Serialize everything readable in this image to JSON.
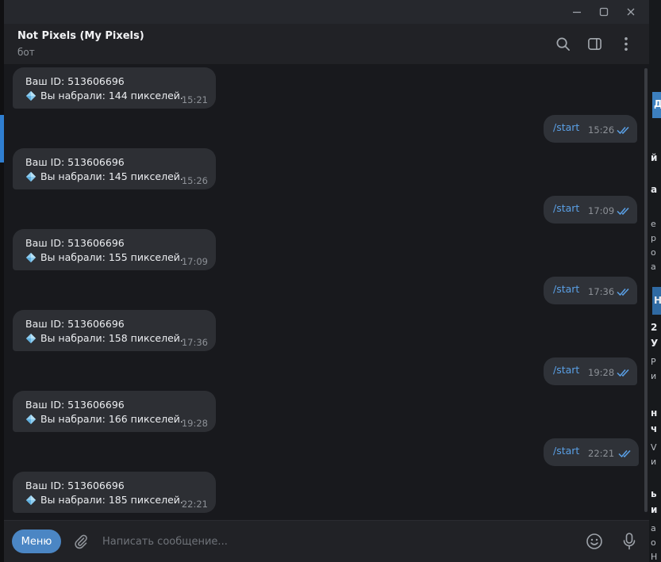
{
  "window": {
    "minimize": "—",
    "maximize": "☐",
    "close": "✕"
  },
  "header": {
    "title": "Not Pixels (My Pixels)",
    "subtitle": "бот"
  },
  "icons": {
    "search": "search-icon",
    "sidebar": "sidebar-toggle-icon",
    "menu": "more-vertical-icon",
    "attach": "paperclip-icon",
    "emoji": "emoji-icon",
    "mic": "microphone-icon",
    "diamond": "diamond-emoji-icon",
    "ticks": "double-check-icon"
  },
  "messages": [
    {
      "type": "in",
      "id_text": "Ваш ID: 513606696",
      "score_text": "Вы набрали: 144 пикселей.",
      "time": "15:21"
    },
    {
      "type": "out",
      "text": "/start",
      "time": "15:26"
    },
    {
      "type": "in",
      "id_text": "Ваш ID: 513606696",
      "score_text": "Вы набрали: 145 пикселей.",
      "time": "15:26"
    },
    {
      "type": "out",
      "text": "/start",
      "time": "17:09"
    },
    {
      "type": "in",
      "id_text": "Ваш ID: 513606696",
      "score_text": "Вы набрали: 155 пикселей.",
      "time": "17:09"
    },
    {
      "type": "out",
      "text": "/start",
      "time": "17:36"
    },
    {
      "type": "in",
      "id_text": "Ваш ID: 513606696",
      "score_text": "Вы набрали: 158 пикселей.",
      "time": "17:36"
    },
    {
      "type": "out",
      "text": "/start",
      "time": "19:28"
    },
    {
      "type": "in",
      "id_text": "Ваш ID: 513606696",
      "score_text": "Вы набрали: 166 пикселей.",
      "time": "19:28"
    },
    {
      "type": "out",
      "text": "/start",
      "time": "22:21"
    },
    {
      "type": "in",
      "id_text": "Ваш ID: 513606696",
      "score_text": "Вы набрали: 185 пикселей.",
      "time": "22:21"
    }
  ],
  "composer": {
    "menu_label": "Меню",
    "placeholder": "Написать сообщение..."
  },
  "background_fragments": {
    "f1": "Д",
    "f2": "й",
    "f3": "а",
    "f4": "е",
    "f5": "р",
    "f6": "о",
    "f7": "а",
    "f8": "Н",
    "f9": "2",
    "f10": "У",
    "f11": "Р",
    "f12": "и",
    "f13": "н",
    "f14": "ч",
    "f15": "V",
    "f16": "и",
    "f17": "ь",
    "f18": "и",
    "f19": "а",
    "f20": "о",
    "f21": "Н"
  },
  "colors": {
    "accent": "#4b86c4",
    "command": "#5aa0e6",
    "tick": "#5aa0e6"
  }
}
